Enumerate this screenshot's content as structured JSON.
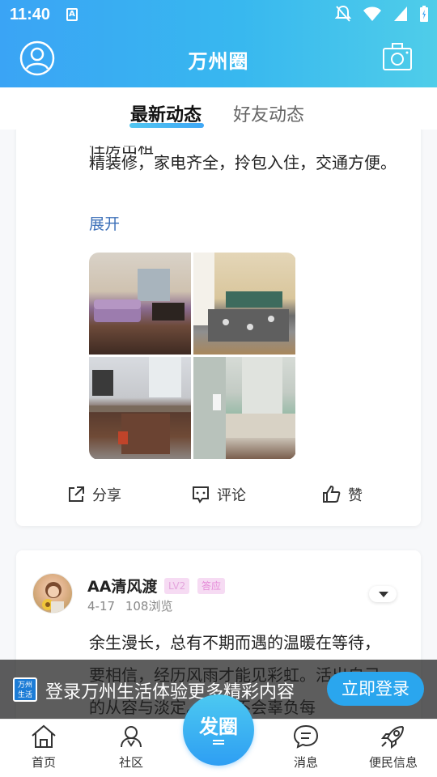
{
  "status_bar": {
    "time": "11:40",
    "a_glyph": "A",
    "icons": [
      "notifications-off-icon",
      "wifi-icon",
      "signal-icon",
      "battery-icon"
    ]
  },
  "header": {
    "title": "万州圈",
    "left_icon": "user-avatar-icon",
    "right_icon": "camera-icon",
    "gradient": [
      "#3aa4f5",
      "#4fcde9"
    ]
  },
  "tabs": [
    {
      "label": "最新动态",
      "active": true
    },
    {
      "label": "好友动态",
      "active": false
    }
  ],
  "feed": {
    "post1": {
      "cut_text": "住房出租",
      "text": "精装修，家电齐全，拎包入住，交通方便。",
      "expand_label": "展开",
      "photos": [
        "living-room-photo",
        "bedroom-photo",
        "kitchen-photo",
        "bathroom-photo"
      ],
      "actions": {
        "share": "分享",
        "comment": "评论",
        "like": "赞"
      }
    },
    "post2": {
      "username": "AA清风渡",
      "level_badge": "LV2",
      "tag_badge": "答应",
      "date": "4-17",
      "views": "108浏览",
      "text": "余生漫长，总有不期而遇的温暖在等待，要相信，经历风雨才能见彩虹。活出自己的从容与淡定。生活不会辜负每"
    }
  },
  "login_banner": {
    "logo_text": "万州生活",
    "text": "登录万州生活体验更多精彩内容",
    "button": "立即登录"
  },
  "bottom_nav": {
    "home": "首页",
    "community": "社区",
    "post": "发圈",
    "messages": "消息",
    "info": "便民信息"
  },
  "colors": {
    "accent": "#2aa6ee",
    "link": "#3b6fb8",
    "badge_bg": "#f6dbf3"
  }
}
